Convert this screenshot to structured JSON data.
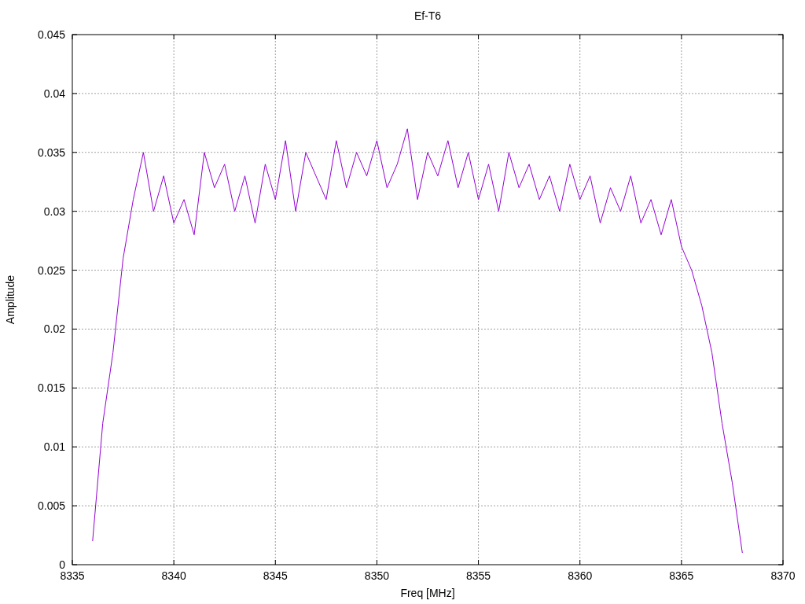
{
  "chart_data": {
    "type": "line",
    "title": "Ef-T6",
    "xlabel": "Freq [MHz]",
    "ylabel": "Amplitude",
    "grid": true,
    "xlim": [
      8335,
      8370
    ],
    "ylim": [
      0,
      0.045
    ],
    "xticks": [
      8335,
      8340,
      8345,
      8350,
      8355,
      8360,
      8365,
      8370
    ],
    "yticks": [
      {
        "value": 0,
        "label": "0"
      },
      {
        "value": 0.005,
        "label": "0.005"
      },
      {
        "value": 0.01,
        "label": "0.01"
      },
      {
        "value": 0.015,
        "label": "0.015"
      },
      {
        "value": 0.02,
        "label": "0.02"
      },
      {
        "value": 0.025,
        "label": "0.025"
      },
      {
        "value": 0.03,
        "label": "0.03"
      },
      {
        "value": 0.035,
        "label": "0.035"
      },
      {
        "value": 0.04,
        "label": "0.04"
      },
      {
        "value": 0.045,
        "label": "0.045"
      }
    ],
    "x": [
      8336,
      8336.5,
      8337,
      8337.5,
      8338,
      8338.5,
      8339,
      8339.5,
      8340,
      8340.5,
      8341,
      8341.5,
      8342,
      8342.5,
      8343,
      8343.5,
      8344,
      8344.5,
      8345,
      8345.5,
      8346,
      8346.5,
      8347,
      8347.5,
      8348,
      8348.5,
      8349,
      8349.5,
      8350,
      8350.5,
      8351,
      8351.5,
      8352,
      8352.5,
      8353,
      8353.5,
      8354,
      8354.5,
      8355,
      8355.5,
      8356,
      8356.5,
      8357,
      8357.5,
      8358,
      8358.5,
      8359,
      8359.5,
      8360,
      8360.5,
      8361,
      8361.5,
      8362,
      8362.5,
      8363,
      8363.5,
      8364,
      8364.5,
      8365,
      8365.5,
      8366,
      8366.5,
      8367,
      8367.5,
      8368
    ],
    "series": [
      {
        "color": "#9400d3",
        "values": [
          0.002,
          0.012,
          0.018,
          0.026,
          0.031,
          0.035,
          0.03,
          0.033,
          0.029,
          0.031,
          0.028,
          0.035,
          0.032,
          0.034,
          0.03,
          0.033,
          0.029,
          0.034,
          0.031,
          0.036,
          0.03,
          0.035,
          0.033,
          0.031,
          0.036,
          0.032,
          0.035,
          0.033,
          0.036,
          0.032,
          0.034,
          0.037,
          0.031,
          0.035,
          0.033,
          0.036,
          0.032,
          0.035,
          0.031,
          0.034,
          0.03,
          0.035,
          0.032,
          0.034,
          0.031,
          0.033,
          0.03,
          0.034,
          0.031,
          0.033,
          0.029,
          0.032,
          0.03,
          0.033,
          0.029,
          0.031,
          0.028,
          0.031,
          0.027,
          0.025,
          0.022,
          0.018,
          0.012,
          0.007,
          0.001
        ]
      }
    ]
  }
}
